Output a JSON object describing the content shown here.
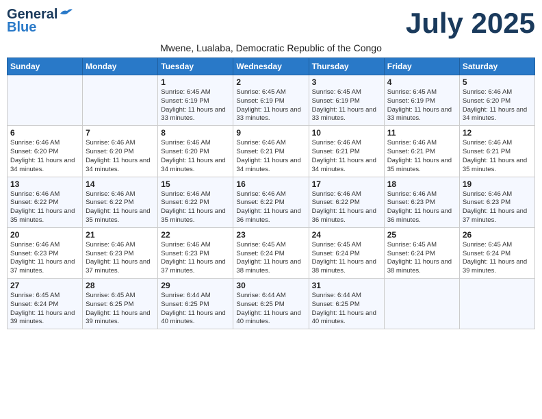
{
  "header": {
    "logo_general": "General",
    "logo_blue": "Blue",
    "month_title": "July 2025",
    "subtitle": "Mwene, Lualaba, Democratic Republic of the Congo"
  },
  "weekdays": [
    "Sunday",
    "Monday",
    "Tuesday",
    "Wednesday",
    "Thursday",
    "Friday",
    "Saturday"
  ],
  "weeks": [
    [
      {
        "day": "",
        "info": ""
      },
      {
        "day": "",
        "info": ""
      },
      {
        "day": "1",
        "info": "Sunrise: 6:45 AM\nSunset: 6:19 PM\nDaylight: 11 hours and 33 minutes."
      },
      {
        "day": "2",
        "info": "Sunrise: 6:45 AM\nSunset: 6:19 PM\nDaylight: 11 hours and 33 minutes."
      },
      {
        "day": "3",
        "info": "Sunrise: 6:45 AM\nSunset: 6:19 PM\nDaylight: 11 hours and 33 minutes."
      },
      {
        "day": "4",
        "info": "Sunrise: 6:45 AM\nSunset: 6:19 PM\nDaylight: 11 hours and 33 minutes."
      },
      {
        "day": "5",
        "info": "Sunrise: 6:46 AM\nSunset: 6:20 PM\nDaylight: 11 hours and 34 minutes."
      }
    ],
    [
      {
        "day": "6",
        "info": "Sunrise: 6:46 AM\nSunset: 6:20 PM\nDaylight: 11 hours and 34 minutes."
      },
      {
        "day": "7",
        "info": "Sunrise: 6:46 AM\nSunset: 6:20 PM\nDaylight: 11 hours and 34 minutes."
      },
      {
        "day": "8",
        "info": "Sunrise: 6:46 AM\nSunset: 6:20 PM\nDaylight: 11 hours and 34 minutes."
      },
      {
        "day": "9",
        "info": "Sunrise: 6:46 AM\nSunset: 6:21 PM\nDaylight: 11 hours and 34 minutes."
      },
      {
        "day": "10",
        "info": "Sunrise: 6:46 AM\nSunset: 6:21 PM\nDaylight: 11 hours and 34 minutes."
      },
      {
        "day": "11",
        "info": "Sunrise: 6:46 AM\nSunset: 6:21 PM\nDaylight: 11 hours and 35 minutes."
      },
      {
        "day": "12",
        "info": "Sunrise: 6:46 AM\nSunset: 6:21 PM\nDaylight: 11 hours and 35 minutes."
      }
    ],
    [
      {
        "day": "13",
        "info": "Sunrise: 6:46 AM\nSunset: 6:22 PM\nDaylight: 11 hours and 35 minutes."
      },
      {
        "day": "14",
        "info": "Sunrise: 6:46 AM\nSunset: 6:22 PM\nDaylight: 11 hours and 35 minutes."
      },
      {
        "day": "15",
        "info": "Sunrise: 6:46 AM\nSunset: 6:22 PM\nDaylight: 11 hours and 35 minutes."
      },
      {
        "day": "16",
        "info": "Sunrise: 6:46 AM\nSunset: 6:22 PM\nDaylight: 11 hours and 36 minutes."
      },
      {
        "day": "17",
        "info": "Sunrise: 6:46 AM\nSunset: 6:22 PM\nDaylight: 11 hours and 36 minutes."
      },
      {
        "day": "18",
        "info": "Sunrise: 6:46 AM\nSunset: 6:23 PM\nDaylight: 11 hours and 36 minutes."
      },
      {
        "day": "19",
        "info": "Sunrise: 6:46 AM\nSunset: 6:23 PM\nDaylight: 11 hours and 37 minutes."
      }
    ],
    [
      {
        "day": "20",
        "info": "Sunrise: 6:46 AM\nSunset: 6:23 PM\nDaylight: 11 hours and 37 minutes."
      },
      {
        "day": "21",
        "info": "Sunrise: 6:46 AM\nSunset: 6:23 PM\nDaylight: 11 hours and 37 minutes."
      },
      {
        "day": "22",
        "info": "Sunrise: 6:46 AM\nSunset: 6:23 PM\nDaylight: 11 hours and 37 minutes."
      },
      {
        "day": "23",
        "info": "Sunrise: 6:45 AM\nSunset: 6:24 PM\nDaylight: 11 hours and 38 minutes."
      },
      {
        "day": "24",
        "info": "Sunrise: 6:45 AM\nSunset: 6:24 PM\nDaylight: 11 hours and 38 minutes."
      },
      {
        "day": "25",
        "info": "Sunrise: 6:45 AM\nSunset: 6:24 PM\nDaylight: 11 hours and 38 minutes."
      },
      {
        "day": "26",
        "info": "Sunrise: 6:45 AM\nSunset: 6:24 PM\nDaylight: 11 hours and 39 minutes."
      }
    ],
    [
      {
        "day": "27",
        "info": "Sunrise: 6:45 AM\nSunset: 6:24 PM\nDaylight: 11 hours and 39 minutes."
      },
      {
        "day": "28",
        "info": "Sunrise: 6:45 AM\nSunset: 6:25 PM\nDaylight: 11 hours and 39 minutes."
      },
      {
        "day": "29",
        "info": "Sunrise: 6:44 AM\nSunset: 6:25 PM\nDaylight: 11 hours and 40 minutes."
      },
      {
        "day": "30",
        "info": "Sunrise: 6:44 AM\nSunset: 6:25 PM\nDaylight: 11 hours and 40 minutes."
      },
      {
        "day": "31",
        "info": "Sunrise: 6:44 AM\nSunset: 6:25 PM\nDaylight: 11 hours and 40 minutes."
      },
      {
        "day": "",
        "info": ""
      },
      {
        "day": "",
        "info": ""
      }
    ]
  ]
}
